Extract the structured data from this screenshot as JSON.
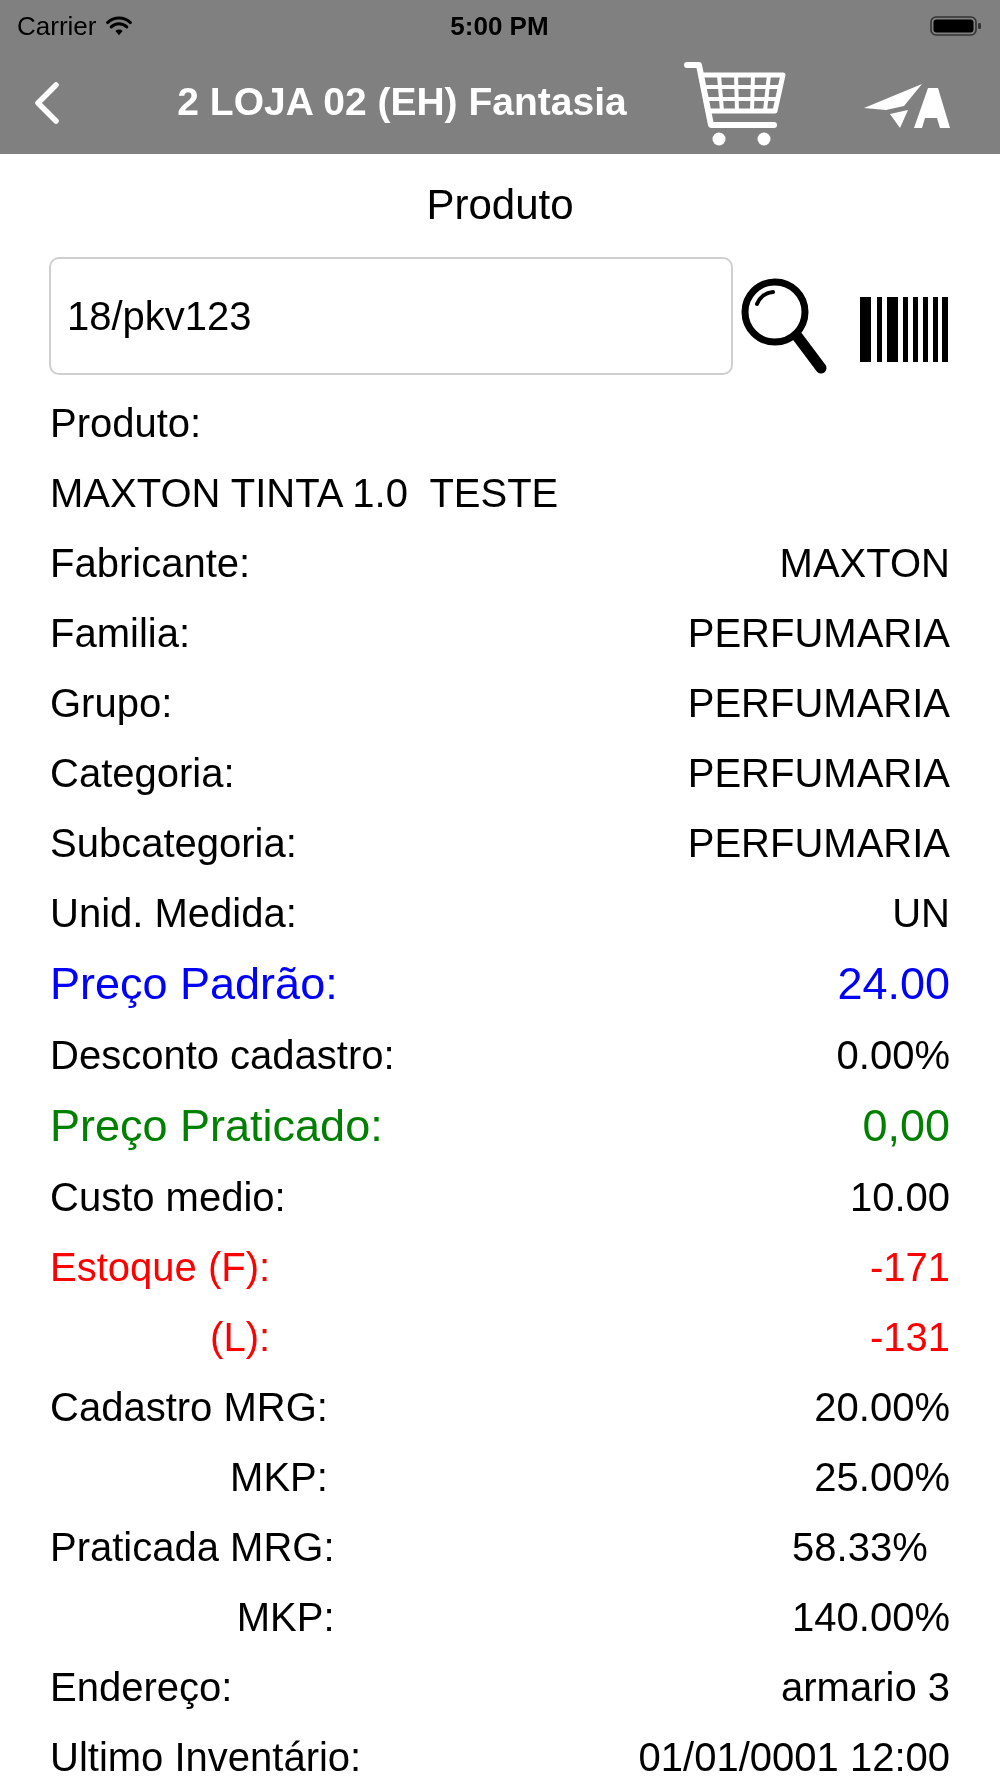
{
  "status_bar": {
    "carrier": "Carrier",
    "time": "5:00 PM"
  },
  "nav_bar": {
    "title": "2 LOJA 02 (EH) Fantasia"
  },
  "page": {
    "title": "Produto"
  },
  "search": {
    "value": "18/pkv123"
  },
  "fields": [
    {
      "kind": "label",
      "label": "Produto:",
      "color": "#000000"
    },
    {
      "kind": "text",
      "text": "MAXTON TINTA 1.0  TESTE",
      "color": "#000000"
    },
    {
      "kind": "pair",
      "label": "Fabricante:",
      "value": "MAXTON",
      "color": "#000000"
    },
    {
      "kind": "pair",
      "label": "Familia:",
      "value": "PERFUMARIA",
      "color": "#000000"
    },
    {
      "kind": "pair",
      "label": "Grupo:",
      "value": "PERFUMARIA",
      "color": "#000000"
    },
    {
      "kind": "pair",
      "label": "Categoria:",
      "value": "PERFUMARIA",
      "color": "#000000"
    },
    {
      "kind": "pair",
      "label": "Subcategoria:",
      "value": "PERFUMARIA",
      "color": "#000000"
    },
    {
      "kind": "pair",
      "label": "Unid. Medida:",
      "value": "UN",
      "color": "#000000"
    },
    {
      "kind": "price",
      "label": "Preço Padrão:",
      "value": "24.00",
      "color": "#0000ff"
    },
    {
      "kind": "pair",
      "label": "Desconto cadastro:",
      "value": "0.00%",
      "color": "#000000"
    },
    {
      "kind": "price",
      "label": "Preço Praticado:",
      "value": "0,00",
      "color": "#008000"
    },
    {
      "kind": "pair",
      "label": "Custo medio:",
      "value": "10.00",
      "color": "#000000"
    },
    {
      "kind": "group",
      "label": "Estoque (F):",
      "value": "-171",
      "color": "#ff0000",
      "sub": {
        "label": "(L):",
        "value": "-131"
      }
    },
    {
      "kind": "group",
      "label": "Cadastro MRG:",
      "value": "20.00%",
      "color": "#000000",
      "sub": {
        "label": "MKP:",
        "value": "25.00%"
      }
    },
    {
      "kind": "group",
      "label": "Praticada MRG:",
      "value": "58.33%",
      "color": "#000000",
      "sub": {
        "label": "MKP:",
        "value": "140.00%"
      }
    },
    {
      "kind": "pair",
      "label": "Endereço:",
      "value": "armario 3",
      "color": "#000000"
    },
    {
      "kind": "pair",
      "label": "Ultimo Inventário:",
      "value": "01/01/0001 12:00",
      "color": "#000000"
    }
  ]
}
